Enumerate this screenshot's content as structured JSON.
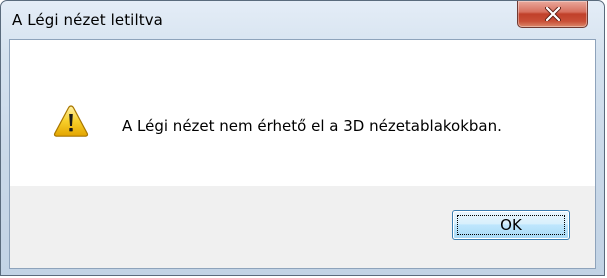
{
  "window": {
    "title": "A Légi nézet letiltva"
  },
  "title_controls": {
    "close_icon": "close-x-icon"
  },
  "dialog": {
    "icon": "warning-icon",
    "message": "A Légi nézet nem érhető el a 3D nézetablakokban."
  },
  "buttons": {
    "ok_label": "OK"
  },
  "colors": {
    "close_button": "#c94f37",
    "warning_fill": "#f5c518",
    "ok_button_border": "#3c7fb1",
    "footer_background": "#f0f0f0"
  }
}
